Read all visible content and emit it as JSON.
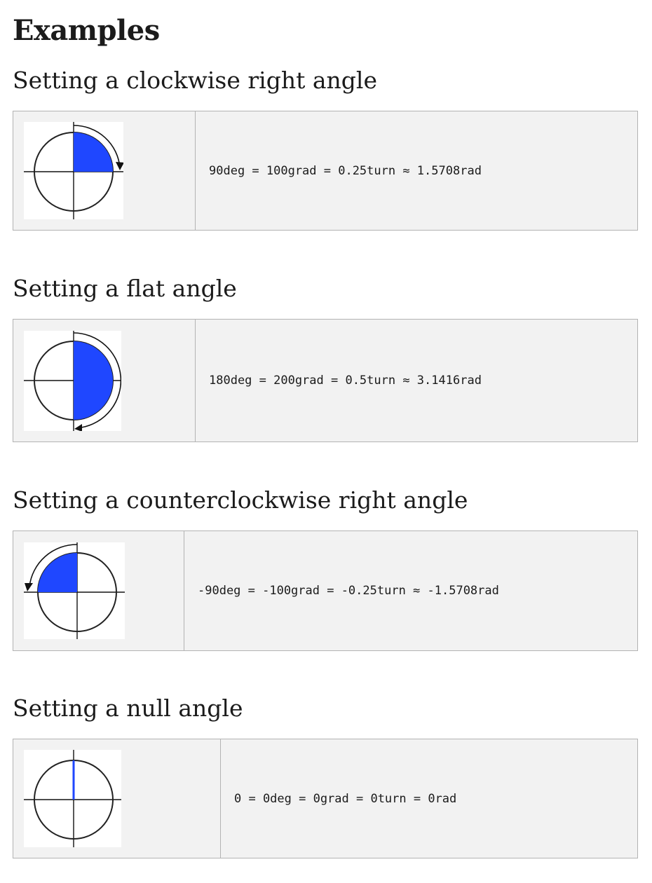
{
  "heading": "Examples",
  "colors": {
    "sector_fill": "#1f47ff",
    "table_background": "#f2f2f2",
    "table_border": "#b3b3b3"
  },
  "examples": [
    {
      "title": "Setting a clockwise right angle",
      "value": "90deg = 100grad = 0.25turn ≈ 1.5708rad",
      "icon": "clockwise-right-angle-diagram"
    },
    {
      "title": "Setting a flat angle",
      "value": "180deg = 200grad = 0.5turn ≈ 3.1416rad",
      "icon": "flat-angle-diagram"
    },
    {
      "title": "Setting a counterclockwise right angle",
      "value": "-90deg = -100grad = -0.25turn ≈ -1.5708rad",
      "icon": "counterclockwise-right-angle-diagram"
    },
    {
      "title": "Setting a null angle",
      "value": "0 = 0deg = 0grad = 0turn = 0rad",
      "icon": "null-angle-diagram"
    }
  ]
}
